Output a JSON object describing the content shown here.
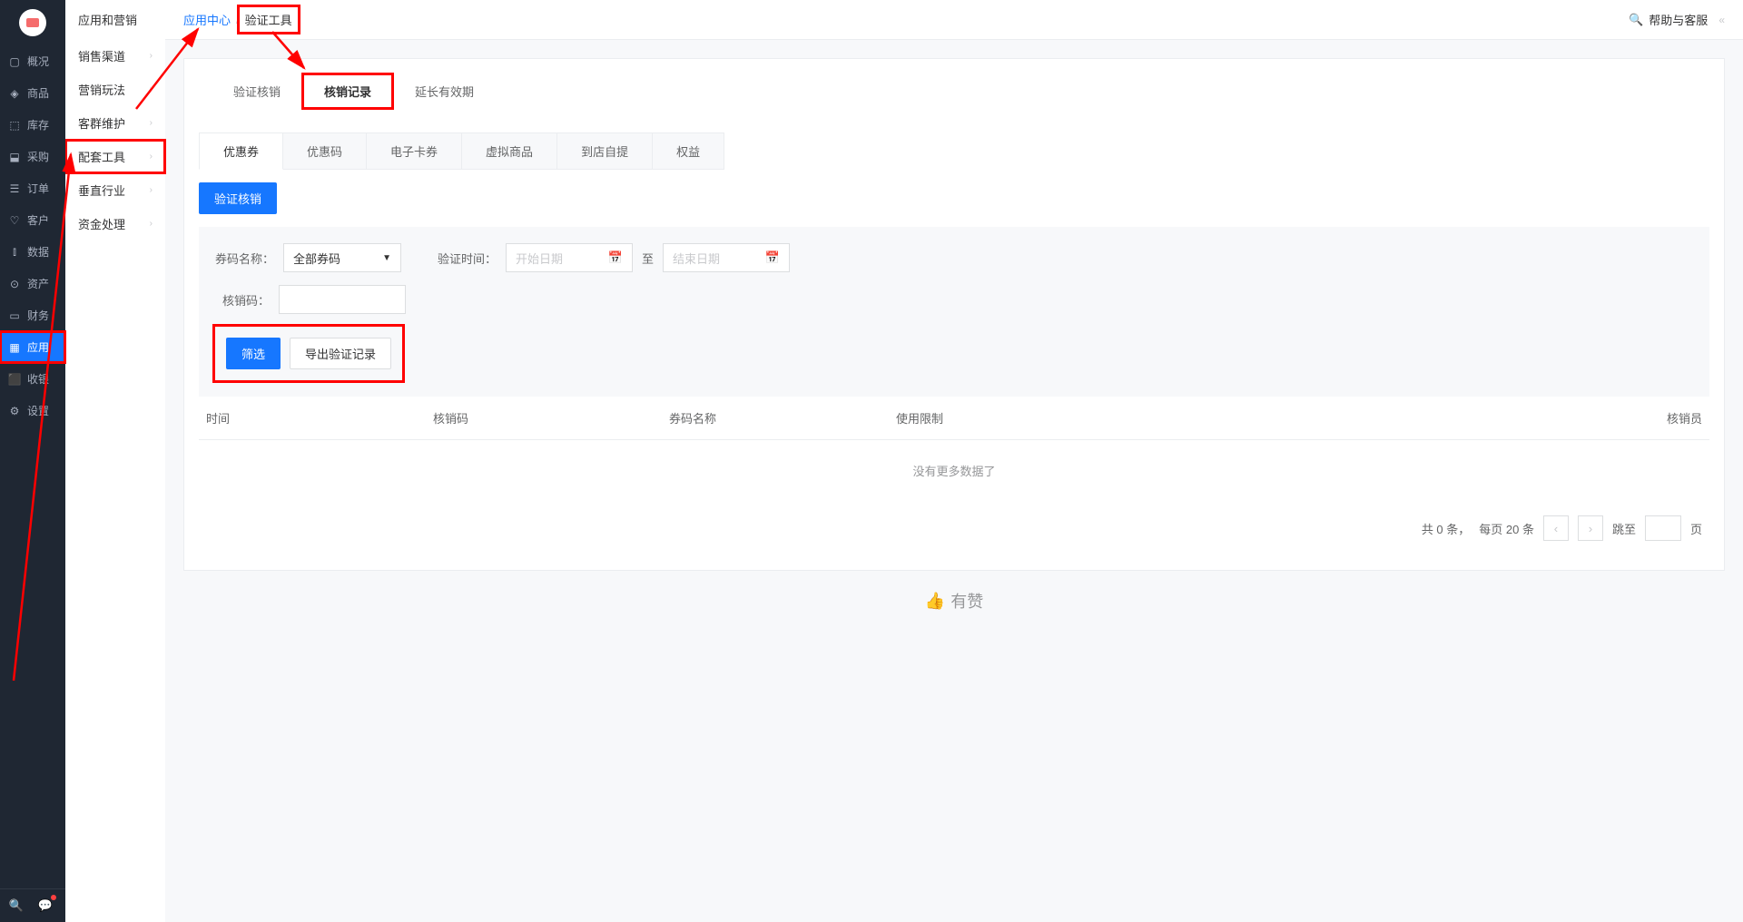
{
  "primaryNav": {
    "items": [
      {
        "icon": "monitor",
        "label": "概况"
      },
      {
        "icon": "tag",
        "label": "商品"
      },
      {
        "icon": "box",
        "label": "库存"
      },
      {
        "icon": "cart",
        "label": "采购"
      },
      {
        "icon": "doc",
        "label": "订单"
      },
      {
        "icon": "user",
        "label": "客户"
      },
      {
        "icon": "bars",
        "label": "数据"
      },
      {
        "icon": "money",
        "label": "资产"
      },
      {
        "icon": "card",
        "label": "财务"
      },
      {
        "icon": "grid",
        "label": "应用"
      },
      {
        "icon": "cash",
        "label": "收银"
      },
      {
        "icon": "gear",
        "label": "设置"
      }
    ]
  },
  "secondaryNav": {
    "title": "应用和营销",
    "items": [
      {
        "label": "销售渠道"
      },
      {
        "label": "营销玩法"
      },
      {
        "label": "客群维护"
      },
      {
        "label": "配套工具"
      },
      {
        "label": "垂直行业"
      },
      {
        "label": "资金处理"
      }
    ]
  },
  "breadcrumb": {
    "link": "应用中心",
    "sep": "/",
    "current": "验证工具"
  },
  "help": {
    "label": "帮助与客服"
  },
  "topTabs": [
    {
      "label": "验证核销"
    },
    {
      "label": "核销记录"
    },
    {
      "label": "延长有效期"
    }
  ],
  "subTabs": [
    {
      "label": "优惠券"
    },
    {
      "label": "优惠码"
    },
    {
      "label": "电子卡券"
    },
    {
      "label": "虚拟商品"
    },
    {
      "label": "到店自提"
    },
    {
      "label": "权益"
    }
  ],
  "buttons": {
    "verify": "验证核销",
    "filter": "筛选",
    "export": "导出验证记录"
  },
  "filters": {
    "couponNameLabel": "券码名称：",
    "couponNameValue": "全部券码",
    "verifyTimeLabel": "验证时间：",
    "startPlaceholder": "开始日期",
    "toText": "至",
    "endPlaceholder": "结束日期",
    "verifyCodeLabel": "核销码："
  },
  "table": {
    "cols": [
      "时间",
      "核销码",
      "券码名称",
      "使用限制",
      "核销员"
    ],
    "empty": "没有更多数据了"
  },
  "pager": {
    "total": "共 0 条，",
    "perPage": "每页 20 条",
    "jump": "跳至",
    "page": "页"
  },
  "footer": {
    "brand": "有赞"
  }
}
